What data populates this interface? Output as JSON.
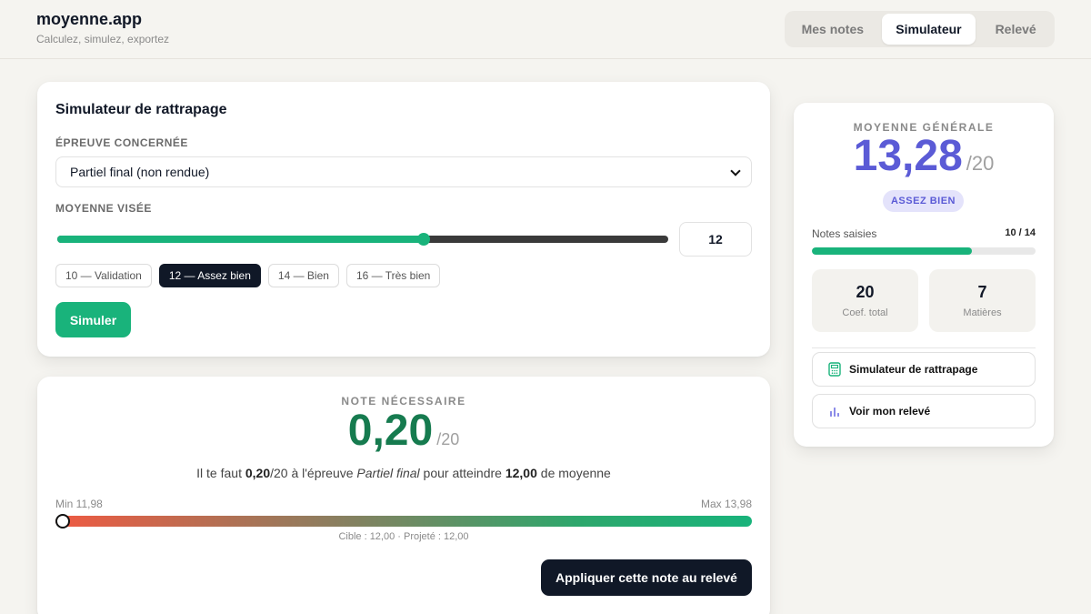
{
  "app": {
    "name": "moyenne.app",
    "tagline": "Calculez, simulez, exportez"
  },
  "tabs": [
    {
      "label": "Mes notes",
      "active": false
    },
    {
      "label": "Simulateur",
      "active": true
    },
    {
      "label": "Relevé",
      "active": false
    }
  ],
  "simulator": {
    "title": "Simulateur de rattrapage",
    "exam_label": "ÉPREUVE CONCERNÉE",
    "exam_selected": "Partiel final (non rendue)",
    "target_label": "MOYENNE VISÉE",
    "target_value": "12",
    "slider_fraction": 0.6,
    "presets": [
      "10 — Validation",
      "12 — Assez bien",
      "14 — Bien",
      "16 — Très bien"
    ],
    "active_preset": 1,
    "simulate_button": "Simuler"
  },
  "result": {
    "label": "NOTE NÉCESSAIRE",
    "value": "0,20",
    "denominator": "/20",
    "sentence": {
      "p1": "Il te faut ",
      "note": "0,20",
      "p2": "/20 à l'épreuve ",
      "exam": "Partiel final",
      "p3": " pour atteindre ",
      "target": "12,00",
      "p4": " de moyenne"
    },
    "min_label": "Min 11,98",
    "max_label": "Max 13,98",
    "gauge_fraction": 0.01,
    "caption": "Cible : 12,00 · Projeté : 12,00",
    "apply_button": "Appliquer cette note au relevé"
  },
  "summary": {
    "label": "MOYENNE GÉNÉRALE",
    "value": "13,28",
    "denominator": "/20",
    "mention": "ASSEZ BIEN",
    "notes_label": "Notes saisies",
    "notes_count": "10 / 14",
    "notes_fraction": 0.714,
    "stats": [
      {
        "value": "20",
        "label": "Coef. total"
      },
      {
        "value": "7",
        "label": "Matières"
      }
    ],
    "buttons": [
      {
        "label": "Simulateur de rattrapage",
        "icon": "calculator-icon"
      },
      {
        "label": "Voir mon relevé",
        "icon": "bar-chart-icon"
      }
    ]
  },
  "colors": {
    "accent_green": "#19b37b",
    "result_green": "#167b4f",
    "accent_indigo": "#5b5bd6",
    "dark": "#101827"
  }
}
